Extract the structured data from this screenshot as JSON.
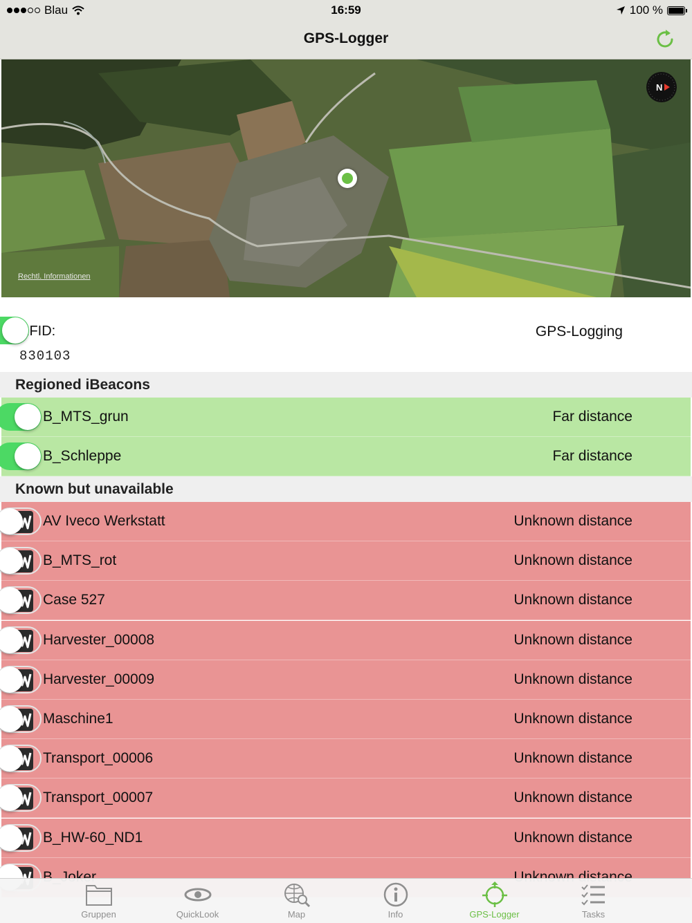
{
  "status_bar": {
    "carrier": "Blau",
    "time": "16:59",
    "battery": "100 %"
  },
  "nav": {
    "title": "GPS-Logger",
    "refresh_icon": "refresh-icon"
  },
  "map": {
    "legal_link": "Rechtl. Informationen",
    "compass_letter": "N"
  },
  "rfid": {
    "label": "RFID:",
    "value": "830103",
    "gps_logging_label": "GPS-Logging",
    "gps_logging_on": true
  },
  "sections": {
    "regioned": {
      "title": "Regioned iBeacons",
      "items": [
        {
          "name": "B_MTS_grun",
          "distance": "Far distance",
          "on": true
        },
        {
          "name": "B_Schleppe",
          "distance": "Far distance",
          "on": true
        }
      ]
    },
    "unavailable": {
      "title": "Known but unavailable",
      "items": [
        {
          "name": "AV Iveco Werkstatt",
          "distance": "Unknown distance",
          "on": false
        },
        {
          "name": "B_MTS_rot",
          "distance": "Unknown distance",
          "on": false
        },
        {
          "name": "Case 527",
          "distance": "Unknown distance",
          "on": false
        },
        {
          "name": "Harvester_00008",
          "distance": "Unknown distance",
          "on": false
        },
        {
          "name": "Harvester_00009",
          "distance": "Unknown distance",
          "on": false
        },
        {
          "name": "Maschine1",
          "distance": "Unknown distance",
          "on": false
        },
        {
          "name": "Transport_00006",
          "distance": "Unknown distance",
          "on": false
        },
        {
          "name": "Transport_00007",
          "distance": "Unknown distance",
          "on": false
        },
        {
          "name": "B_HW-60_ND1",
          "distance": "Unknown distance",
          "on": false
        },
        {
          "name": "B_Joker",
          "distance": "Unknown distance",
          "on": false
        }
      ]
    }
  },
  "tabs": [
    {
      "label": "Gruppen",
      "icon": "folder-icon",
      "active": false
    },
    {
      "label": "QuickLook",
      "icon": "eye-icon",
      "active": false
    },
    {
      "label": "Map",
      "icon": "globe-search-icon",
      "active": false
    },
    {
      "label": "Info",
      "icon": "info-icon",
      "active": false
    },
    {
      "label": "GPS-Logger",
      "icon": "gps-target-icon",
      "active": true
    },
    {
      "label": "Tasks",
      "icon": "checklist-icon",
      "active": false
    }
  ],
  "colors": {
    "accent_green": "#6bbf45",
    "toggle_on": "#4cd964",
    "row_green": "#b9e7a3",
    "row_red": "#e99494"
  }
}
